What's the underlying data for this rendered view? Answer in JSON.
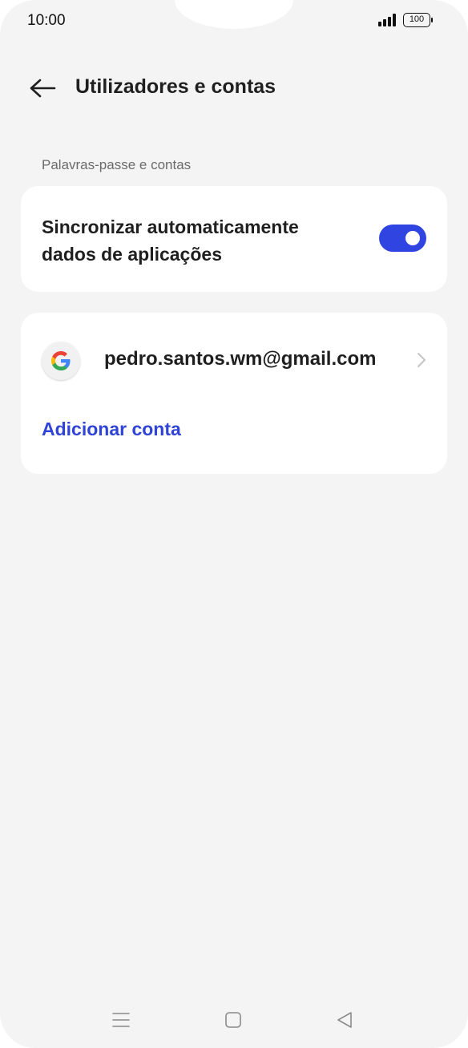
{
  "status_bar": {
    "time": "10:00",
    "battery": "100",
    "signal_icon": "signal-bars-icon",
    "battery_icon": "battery-icon"
  },
  "header": {
    "title": "Utilizadores e contas",
    "back_icon": "arrow-left-icon"
  },
  "section": {
    "label": "Palavras-passe e contas"
  },
  "sync": {
    "label": "Sincronizar automaticamente dados de aplicações",
    "enabled": true,
    "toggle_color": "#2f44e0"
  },
  "accounts": {
    "items": [
      {
        "icon": "google-icon",
        "email": "pedro.santos.wm@gmail.com"
      }
    ],
    "add_label": "Adicionar conta",
    "add_color": "#2f44d6"
  },
  "nav_bar": {
    "menu_icon": "menu-icon",
    "home_icon": "home-icon",
    "back_icon": "back-triangle-icon"
  }
}
